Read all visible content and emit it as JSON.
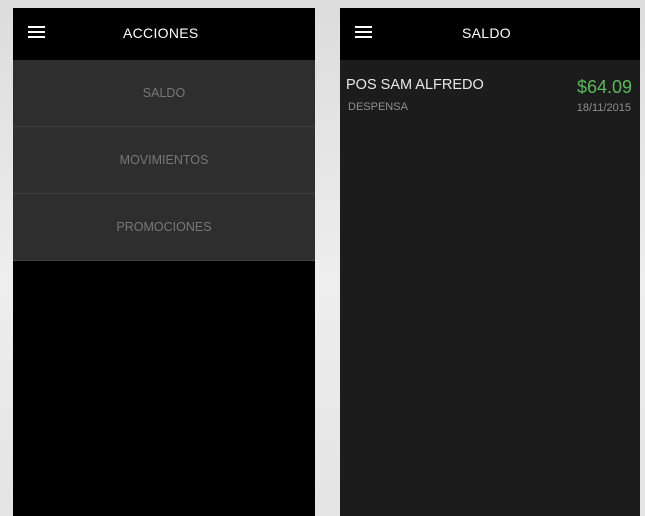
{
  "colors": {
    "amount_green": "#5cb85c",
    "menu_item_bg": "#2e2e2e",
    "appbar_bg": "#000000"
  },
  "left_screen": {
    "title": "ACCIONES",
    "menu_icon": "hamburger-menu-icon",
    "menu_items": [
      {
        "label": "SALDO"
      },
      {
        "label": "MOVIMIENTOS"
      },
      {
        "label": "PROMOCIONES"
      }
    ]
  },
  "right_screen": {
    "title": "SALDO",
    "menu_icon": "hamburger-menu-icon",
    "items": [
      {
        "merchant": "POS SAM  ALFREDO",
        "category": "DESPENSA",
        "amount": "$64.09",
        "date": "18/11/2015"
      }
    ]
  }
}
